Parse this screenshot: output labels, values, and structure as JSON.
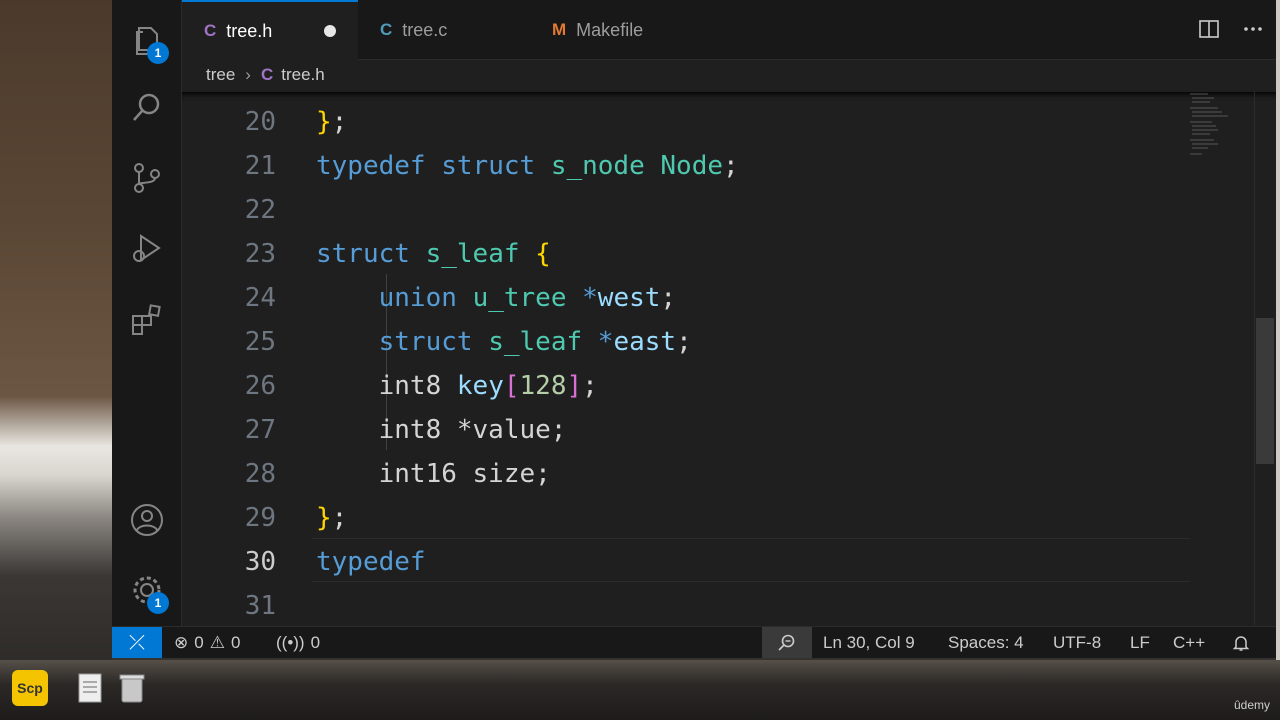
{
  "tabs": [
    {
      "icon_letter": "C",
      "label": "tree.h",
      "active": true,
      "dirty": true
    },
    {
      "icon_letter": "C",
      "label": "tree.c",
      "active": false
    },
    {
      "icon_letter": "M",
      "label": "Makefile",
      "active": false
    }
  ],
  "breadcrumb": {
    "folder": "tree",
    "file_icon": "C",
    "file": "tree.h"
  },
  "activity_bar": {
    "explorer_badge": "1",
    "settings_badge": "1"
  },
  "editor": {
    "lines": [
      {
        "n": "20",
        "tokens": [
          {
            "c": "br1",
            "t": "}"
          },
          {
            "c": "pun",
            "t": ";"
          }
        ]
      },
      {
        "n": "21",
        "tokens": [
          {
            "c": "kw",
            "t": "typedef"
          },
          {
            "c": "plain",
            "t": " "
          },
          {
            "c": "kw",
            "t": "struct"
          },
          {
            "c": "plain",
            "t": " "
          },
          {
            "c": "ty",
            "t": "s_node"
          },
          {
            "c": "plain",
            "t": " "
          },
          {
            "c": "ty",
            "t": "Node"
          },
          {
            "c": "pun",
            "t": ";"
          }
        ]
      },
      {
        "n": "22",
        "tokens": []
      },
      {
        "n": "23",
        "tokens": [
          {
            "c": "kw",
            "t": "struct"
          },
          {
            "c": "plain",
            "t": " "
          },
          {
            "c": "ty",
            "t": "s_leaf"
          },
          {
            "c": "plain",
            "t": " "
          },
          {
            "c": "br1",
            "t": "{"
          }
        ]
      },
      {
        "n": "24",
        "tokens": [
          {
            "c": "plain",
            "t": "    "
          },
          {
            "c": "kw",
            "t": "union"
          },
          {
            "c": "plain",
            "t": " "
          },
          {
            "c": "ty",
            "t": "u_tree"
          },
          {
            "c": "plain",
            "t": " "
          },
          {
            "c": "kw",
            "t": "*"
          },
          {
            "c": "var",
            "t": "west"
          },
          {
            "c": "pun",
            "t": ";"
          }
        ]
      },
      {
        "n": "25",
        "tokens": [
          {
            "c": "plain",
            "t": "    "
          },
          {
            "c": "kw",
            "t": "struct"
          },
          {
            "c": "plain",
            "t": " "
          },
          {
            "c": "ty",
            "t": "s_leaf"
          },
          {
            "c": "plain",
            "t": " "
          },
          {
            "c": "kw",
            "t": "*"
          },
          {
            "c": "var",
            "t": "east"
          },
          {
            "c": "pun",
            "t": ";"
          }
        ]
      },
      {
        "n": "26",
        "tokens": [
          {
            "c": "plain",
            "t": "    int8 "
          },
          {
            "c": "var",
            "t": "key"
          },
          {
            "c": "br2",
            "t": "["
          },
          {
            "c": "num",
            "t": "128"
          },
          {
            "c": "br2",
            "t": "]"
          },
          {
            "c": "pun",
            "t": ";"
          }
        ]
      },
      {
        "n": "27",
        "tokens": [
          {
            "c": "plain",
            "t": "    int8 *value;"
          }
        ]
      },
      {
        "n": "28",
        "tokens": [
          {
            "c": "plain",
            "t": "    int16 size;"
          }
        ]
      },
      {
        "n": "29",
        "tokens": [
          {
            "c": "br1",
            "t": "}"
          },
          {
            "c": "pun",
            "t": ";"
          }
        ]
      },
      {
        "n": "30",
        "tokens": [
          {
            "c": "kw",
            "t": "typedef"
          }
        ],
        "current": true
      },
      {
        "n": "31",
        "tokens": []
      }
    ]
  },
  "status": {
    "errors": "0",
    "warnings": "0",
    "ports": "0",
    "cursor": "Ln 30, Col 9",
    "spaces": "Spaces: 4",
    "encoding": "UTF-8",
    "eol": "LF",
    "language": "C++"
  },
  "dock": {
    "scp_label": "Scp"
  },
  "watermark": "ûdemy",
  "colors": {
    "accent": "#0078d4",
    "editor_bg": "#1f1f1f",
    "sidebar_bg": "#181818"
  }
}
